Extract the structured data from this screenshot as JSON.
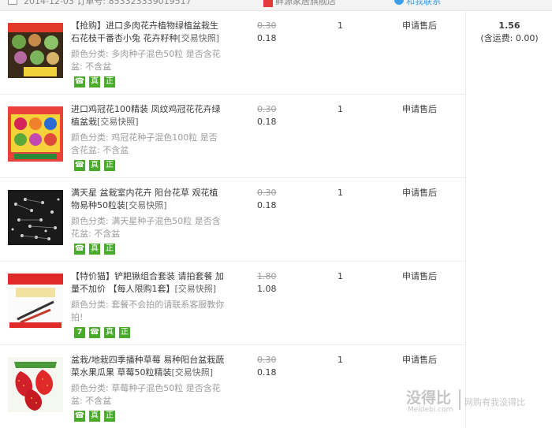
{
  "header": {
    "order_info": "2014-12-03  订单号: 853323339019517",
    "store_name": "鲜源家居旗舰店",
    "contact": "和我联系"
  },
  "orders": [
    {
      "title": "【抢购】进口多肉花卉植物绿植盆栽生石花枝干番杏小兔 花卉籽种",
      "snapshot": "[交易快照]",
      "attribute": "颜色分类: 多肉种子混色50粒 是否含花盆: 不含盆",
      "original_price": "0.30",
      "price": "0.18",
      "quantity": "1",
      "service": "申请售后",
      "image_name": "succulent-seeds-image"
    },
    {
      "title": "进口鸡冠花100精装 凤纹鸡冠花花卉绿植盆栽",
      "snapshot": "[交易快照]",
      "attribute": "颜色分类: 鸡冠花种子混色100粒 是否含花盆: 不含盆",
      "original_price": "0.30",
      "price": "0.18",
      "quantity": "1",
      "service": "申请售后",
      "image_name": "celosia-seeds-image"
    },
    {
      "title": "满天星 盆栽室内花卉 阳台花草 观花植物易种50粒装",
      "snapshot": "[交易快照]",
      "attribute": "颜色分类: 满天星种子混色50粒 是否含花盆: 不含盆",
      "original_price": "0.30",
      "price": "0.18",
      "quantity": "1",
      "service": "申请售后",
      "image_name": "babys-breath-image"
    },
    {
      "title": "【特价猫】铲耙锹组合套装 请拍套餐 加量不加价 【每人限购1套】",
      "snapshot": "[交易快照]",
      "attribute": "颜色分类: 套餐不会拍的请联系客服教你拍!",
      "original_price": "1.80",
      "price": "1.08",
      "quantity": "1",
      "service": "申请售后",
      "image_name": "garden-tool-set-image"
    },
    {
      "title": "盆栽/地栽四季播种草莓 易种阳台盆栽蔬菜水果瓜果 草莓50粒精装",
      "snapshot": "[交易快照]",
      "attribute": "颜色分类: 草莓种子混色50粒 是否含花盆: 不含盆",
      "original_price": "0.30",
      "price": "0.18",
      "quantity": "1",
      "service": "申请售后",
      "image_name": "strawberry-seeds-image"
    }
  ],
  "service_icons": {
    "seven_day": "7",
    "genuine": "真",
    "authentic": "正"
  },
  "summary": {
    "total": "1.56",
    "shipping": "(含运费: 0.00)"
  },
  "watermark": {
    "logo": "没得比",
    "site": "Meidebi.com",
    "slogan": "网购有我没得比"
  }
}
